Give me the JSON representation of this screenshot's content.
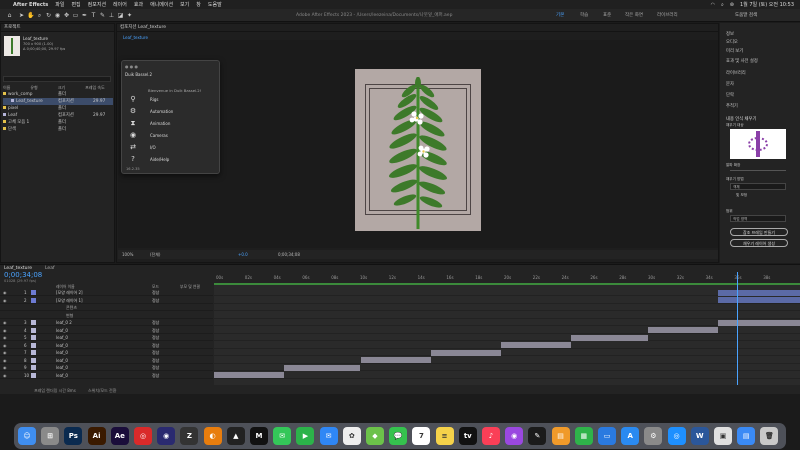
{
  "menubar": {
    "app_name": "After Effects",
    "items": [
      "파일",
      "편집",
      "컴포지션",
      "레이어",
      "효과",
      "애니메이션",
      "보기",
      "창",
      "도움말"
    ],
    "title": "Adobe After Effects 2023 - /Users/leezeina/Documents/나뭇잎_애퍼.aep",
    "clock": "1월 7일 (토) 오전 10:53"
  },
  "toolbar": {
    "workspace_tabs": [
      {
        "label": "기본",
        "active": true
      },
      {
        "label": "학습",
        "active": false
      },
      {
        "label": "표준",
        "active": false
      },
      {
        "label": "작은 화면",
        "active": false
      },
      {
        "label": "라이브러리",
        "active": false
      }
    ],
    "help_search": "도움말 검색",
    "tools": [
      "selection-icon",
      "hand-icon",
      "zoom-icon",
      "rotate-icon",
      "camera-icon",
      "pan-icon",
      "rect-icon",
      "pen-icon",
      "text-icon",
      "brush-icon",
      "stamp-icon",
      "eraser-icon",
      "puppet-icon"
    ]
  },
  "project": {
    "tab_label": "프로젝트",
    "comp_name": "Leaf_texture",
    "comp_info": "700 x 900 (1.00)",
    "comp_duration": "Δ 0;00;40;00, 29.97 fps",
    "search_placeholder": "",
    "columns": [
      "이름",
      "유형",
      "크기",
      "프레임 속도"
    ],
    "rows": [
      {
        "name": "work_comp",
        "type": "폴더",
        "fps": ""
      },
      {
        "name": "Leaf_texture",
        "type": "컴포지션",
        "fps": "29.97"
      },
      {
        "name": "pixel",
        "type": "폴더",
        "fps": ""
      },
      {
        "name": "Leaf",
        "type": "컴포지션",
        "fps": "29.97"
      },
      {
        "name": "고체 모음 1",
        "type": "폴더",
        "fps": ""
      },
      {
        "name": "단색",
        "type": "폴더",
        "fps": ""
      }
    ]
  },
  "comp": {
    "tab_label": "컴포지션 Leaf_texture",
    "breadcrumb": "Leaf_texture",
    "zoom": "100%",
    "resolution": "(전체)",
    "exposure": "+0.0",
    "timecode": "0;00;34;08"
  },
  "plugin": {
    "title": "Duik Bassel.2",
    "subtitle": "Bienvenue in Duik Bassel.2!",
    "items": [
      {
        "icon": "rig-icon",
        "label": "Rigs"
      },
      {
        "icon": "automation-icon",
        "label": "Automation"
      },
      {
        "icon": "animation-icon",
        "label": "Animation"
      },
      {
        "icon": "camera-icon",
        "label": "Cameras"
      },
      {
        "icon": "io-icon",
        "label": "I/O"
      },
      {
        "icon": "help-icon",
        "label": "Aide/Help"
      }
    ],
    "version": "16.2.35"
  },
  "right_panel": {
    "items": [
      "정보",
      "오디오",
      "미리 보기",
      "효과 및 사전 설정",
      "라이브러리",
      "문자",
      "단락",
      "추적기"
    ],
    "section_title": "내용 인식 채우기",
    "fill_label": "채우기 대상",
    "alpha_label": "알파 확장",
    "method_label": "채우기 방법",
    "method_value": "객체",
    "light_fix": "빛 보정",
    "range_label": "범위",
    "range_value": "작업 영역",
    "btn_ref": "참조 프레임 만들기",
    "btn_fill": "채우기 레이어 생성"
  },
  "timeline": {
    "tab_label": "Leaf_texture",
    "tab2_label": "Leaf",
    "timecode": "0;00;34;08",
    "timecode_sub": "01028 (29.97 fps)",
    "columns": [
      "레이어 이름",
      "모드",
      "부모 및 연결"
    ],
    "ticks": [
      "00s",
      "02s",
      "04s",
      "06s",
      "08s",
      "10s",
      "12s",
      "14s",
      "16s",
      "18s",
      "20s",
      "22s",
      "24s",
      "26s",
      "28s",
      "30s",
      "32s",
      "34s",
      "36s",
      "38s"
    ],
    "footer_left": "프레임 렌더링 시간 8ms",
    "footer_right": "스위치/모드 전환",
    "layers": [
      {
        "num": "1",
        "name": "[모양 레이어 2]",
        "mode": "정상",
        "color": "#6d7bd3",
        "bar_start": 0.86,
        "bar_end": 1.0,
        "blue": true
      },
      {
        "num": "2",
        "name": "[모양 레이어 1]",
        "mode": "정상",
        "color": "#6d7bd3",
        "bar_start": 0.86,
        "bar_end": 1.0,
        "blue": true
      },
      {
        "num": "",
        "name": "콘텐츠",
        "mode": "",
        "color": "",
        "bar_start": 0,
        "bar_end": 0,
        "blue": false
      },
      {
        "num": "",
        "name": "변형",
        "mode": "",
        "color": "",
        "bar_start": 0,
        "bar_end": 0,
        "blue": false
      },
      {
        "num": "3",
        "name": "leaf_0 2",
        "mode": "정상",
        "color": "#b7b7d6",
        "bar_start": 0.86,
        "bar_end": 1.0,
        "blue": false
      },
      {
        "num": "4",
        "name": "leaf_0",
        "mode": "정상",
        "color": "#b7b7d6",
        "bar_start": 0.74,
        "bar_end": 0.86,
        "blue": false
      },
      {
        "num": "5",
        "name": "leaf_0",
        "mode": "정상",
        "color": "#b7b7d6",
        "bar_start": 0.61,
        "bar_end": 0.74,
        "blue": false
      },
      {
        "num": "6",
        "name": "leaf_0",
        "mode": "정상",
        "color": "#b7b7d6",
        "bar_start": 0.49,
        "bar_end": 0.61,
        "blue": false
      },
      {
        "num": "7",
        "name": "leaf_0",
        "mode": "정상",
        "color": "#b7b7d6",
        "bar_start": 0.37,
        "bar_end": 0.49,
        "blue": false
      },
      {
        "num": "8",
        "name": "leaf_0",
        "mode": "정상",
        "color": "#b7b7d6",
        "bar_start": 0.25,
        "bar_end": 0.37,
        "blue": false
      },
      {
        "num": "9",
        "name": "leaf_0",
        "mode": "정상",
        "color": "#b7b7d6",
        "bar_start": 0.12,
        "bar_end": 0.25,
        "blue": false
      },
      {
        "num": "10",
        "name": "leaf_0",
        "mode": "정상",
        "color": "#b7b7d6",
        "bar_start": 0.0,
        "bar_end": 0.12,
        "blue": false
      }
    ]
  },
  "dock": {
    "apps": [
      {
        "name": "Finder",
        "color": "#3f8ef0",
        "glyph": "☺"
      },
      {
        "name": "Launchpad",
        "color": "#8a8a8a",
        "glyph": "⊞"
      },
      {
        "name": "Photoshop",
        "color": "#0a2a4f",
        "glyph": "Ps"
      },
      {
        "name": "Illustrator",
        "color": "#3a1a00",
        "glyph": "Ai"
      },
      {
        "name": "After Effects",
        "color": "#1a0d3a",
        "glyph": "Ae"
      },
      {
        "name": "Creative Cloud",
        "color": "#da2a2a",
        "glyph": "◎"
      },
      {
        "name": "Cinema 4D",
        "color": "#2a2a70",
        "glyph": "◉"
      },
      {
        "name": "ZBrush",
        "color": "#333",
        "glyph": "Z"
      },
      {
        "name": "Blender",
        "color": "#e87d0d",
        "glyph": "◐"
      },
      {
        "name": "Animate",
        "color": "#222",
        "glyph": "▲"
      },
      {
        "name": "Capture",
        "color": "#111",
        "glyph": "M"
      },
      {
        "name": "Messages",
        "color": "#34c759",
        "glyph": "✉"
      },
      {
        "name": "FaceTime",
        "color": "#2cb34a",
        "glyph": "▶"
      },
      {
        "name": "Mail",
        "color": "#2f87f5",
        "glyph": "✉"
      },
      {
        "name": "Photos",
        "color": "#eeeeee",
        "glyph": "✿"
      },
      {
        "name": "Maps",
        "color": "#6cc24a",
        "glyph": "◆"
      },
      {
        "name": "Messenger",
        "color": "#35c24e",
        "glyph": "💬"
      },
      {
        "name": "Calendar",
        "color": "#ffffff",
        "glyph": "7"
      },
      {
        "name": "Notes",
        "color": "#f5d24a",
        "glyph": "≡"
      },
      {
        "name": "TV",
        "color": "#111",
        "glyph": "tv"
      },
      {
        "name": "Music",
        "color": "#fa3f57",
        "glyph": "♪"
      },
      {
        "name": "Podcasts",
        "color": "#9a48e0",
        "glyph": "◉"
      },
      {
        "name": "Brush",
        "color": "#1b1b1b",
        "glyph": "✎"
      },
      {
        "name": "Pages",
        "color": "#f09a2a",
        "glyph": "▤"
      },
      {
        "name": "Numbers",
        "color": "#2fb34a",
        "glyph": "▦"
      },
      {
        "name": "Keynote",
        "color": "#2a7ae0",
        "glyph": "▭"
      },
      {
        "name": "App Store",
        "color": "#2a8af0",
        "glyph": "A"
      },
      {
        "name": "Settings",
        "color": "#8a8a8a",
        "glyph": "⚙"
      },
      {
        "name": "Safari",
        "color": "#1e90ff",
        "glyph": "◎"
      },
      {
        "name": "Word",
        "color": "#2b579a",
        "glyph": "W"
      },
      {
        "name": "Preview",
        "color": "#e0e0e0",
        "glyph": "▣"
      },
      {
        "name": "Finder2",
        "color": "#3a8af5",
        "glyph": "▤"
      },
      {
        "name": "Trash",
        "color": "#c9c9c9",
        "glyph": "🗑"
      }
    ]
  }
}
